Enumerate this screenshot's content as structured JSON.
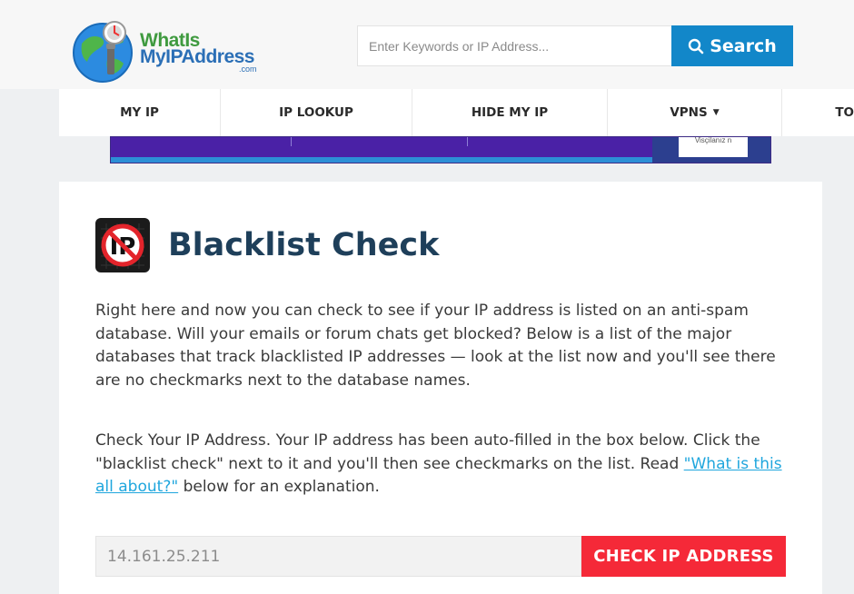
{
  "header": {
    "logo": {
      "line1": "WhatIs",
      "line2": "MyIPAddress",
      "suffix": ".com"
    },
    "search": {
      "placeholder": "Enter Keywords or IP Address...",
      "value": "",
      "button_label": "Search"
    }
  },
  "nav": {
    "items": [
      {
        "label": "MY IP"
      },
      {
        "label": "IP LOOKUP"
      },
      {
        "label": "HIDE MY IP"
      },
      {
        "label": "VPNS",
        "dropdown": true
      },
      {
        "label": "TO"
      }
    ]
  },
  "ad": {
    "text": "Visçilanız n"
  },
  "main": {
    "title": "Blacklist Check",
    "intro": "Right here and now you can check to see if your IP address is listed on an anti-spam database. Will your emails or forum chats get blocked? Below is a list of the major databases that track blacklisted IP addresses — look at the list now and you'll see there are no checkmarks next to the database names.",
    "instructions_before": "Check Your IP Address. Your IP address has been auto-filled in the box below. Click the \"blacklist check\" next to it and you'll then see checkmarks on the list. Read ",
    "instructions_link": "\"What is this all about?\"",
    "instructions_after": " below for an explanation.",
    "ip_value": "14.161.25.211",
    "check_button_label": "CHECK IP ADDRESS"
  },
  "icons": {
    "search": "search-icon",
    "blacklist": "no-ip-icon",
    "logo_globe": "globe-icon",
    "caret": "caret-down-icon"
  },
  "colors": {
    "accent_blue": "#1287c9",
    "check_red": "#f52938",
    "title_navy": "#1e3f5a",
    "link_blue": "#1fa6dd"
  }
}
